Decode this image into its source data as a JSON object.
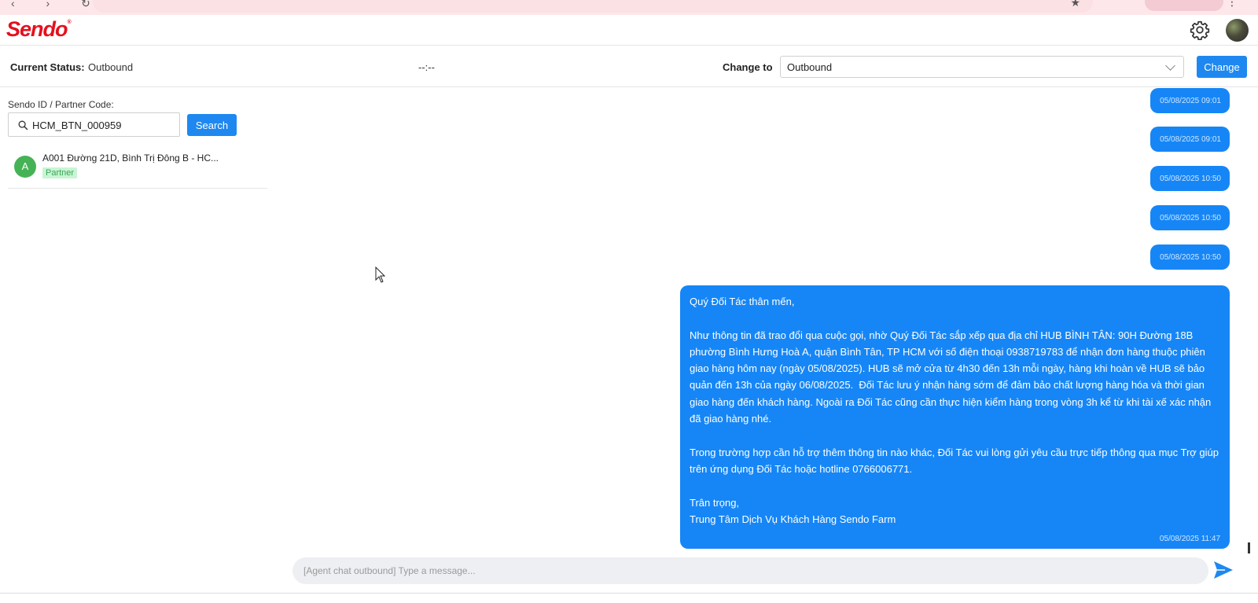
{
  "app": {
    "brand": "Sendo",
    "brand_mark": "®",
    "colors": {
      "brand_red": "#e5101d",
      "primary_blue": "#1e88f0",
      "bubble_blue": "#1686f6",
      "partner_green": "#46b256"
    },
    "icons": [
      "gear-icon",
      "avatar",
      "search-icon",
      "send-icon",
      "chevron-down-icon"
    ]
  },
  "status": {
    "current_label": "Current Status:",
    "current_value": "Outbound",
    "timer": "--:--",
    "change_to_label": "Change to",
    "selected_option": "Outbound",
    "change_button": "Change"
  },
  "search": {
    "label": "Sendo ID / Partner Code:",
    "value": "HCM_BTN_000959",
    "button": "Search"
  },
  "results": [
    {
      "initial": "A",
      "title": "A001 Đường 21D, Bình Trị Đông B - HC...",
      "tag": "Partner"
    }
  ],
  "chat": {
    "timestamps_only": [
      "05/08/2025 09:01",
      "05/08/2025 09:01",
      "05/08/2025 10:50",
      "05/08/2025 10:50",
      "05/08/2025 10:50"
    ],
    "message": {
      "text": "Quý Đối Tác thân mến,\n\nNhư thông tin đã trao đổi qua cuộc gọi, nhờ Quý Đối Tác sắp xếp qua địa chỉ HUB BÌNH TÂN: 90H Đường 18B phường Bình Hưng Hoà A, quận Bình Tân, TP HCM với số điện thoại 0938719783 để nhận đơn hàng thuộc phiên giao hàng hôm nay (ngày 05/08/2025). HUB sẽ mở cửa từ 4h30 đến 13h mỗi ngày, hàng khi hoàn về HUB sẽ bảo quản đến 13h của ngày 06/08/2025.  Đối Tác lưu ý nhận hàng sớm để đảm bảo chất lượng hàng hóa và thời gian giao hàng đến khách hàng. Ngoài ra Đối Tác cũng cần thực hiện kiểm hàng trong vòng 3h kể từ khi tài xế xác nhận đã giao hàng nhé.\n\nTrong trường hợp cần hỗ trợ thêm thông tin nào khác, Đối Tác vui lòng gửi yêu cầu trực tiếp thông qua mục Trợ giúp trên ứng dụng Đối Tác hoặc hotline 0766006771.\n\nTrân trọng,\nTrung Tâm Dịch Vụ Khách Hàng Sendo Farm",
      "time": "05/08/2025 11:47"
    },
    "composer_placeholder": "[Agent chat outbound] Type a message..."
  }
}
